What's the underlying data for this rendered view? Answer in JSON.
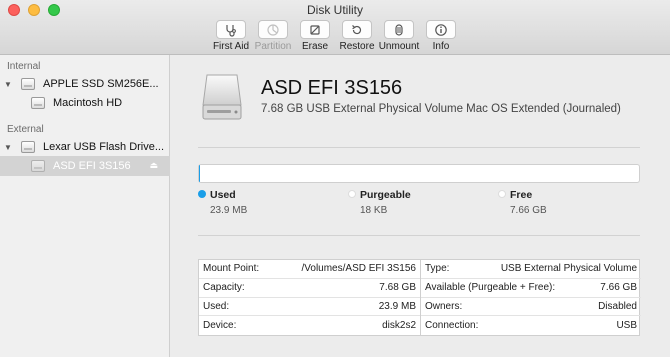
{
  "window": {
    "title": "Disk Utility"
  },
  "toolbar": [
    {
      "label": "First Aid",
      "icon": "stethoscope-icon",
      "enabled": true
    },
    {
      "label": "Partition",
      "icon": "pie-icon",
      "enabled": false
    },
    {
      "label": "Erase",
      "icon": "eraser-icon",
      "enabled": true
    },
    {
      "label": "Restore",
      "icon": "restore-icon",
      "enabled": true
    },
    {
      "label": "Unmount",
      "icon": "unmount-icon",
      "enabled": true
    },
    {
      "label": "Info",
      "icon": "info-icon",
      "enabled": true
    }
  ],
  "sidebar": {
    "internal_header": "Internal",
    "external_header": "External",
    "items": [
      {
        "label": "APPLE SSD SM256E...",
        "level": 0,
        "expanded": true
      },
      {
        "label": "Macintosh HD",
        "level": 1
      },
      {
        "label": "Lexar USB Flash Drive...",
        "level": 0,
        "expanded": true
      },
      {
        "label": "ASD EFI 3S156",
        "level": 1,
        "selected": true,
        "eject": "⏏"
      }
    ]
  },
  "volume": {
    "name": "ASD EFI 3S156",
    "subtitle": "7.68 GB USB External Physical Volume Mac OS Extended (Journaled)"
  },
  "usage": {
    "used_fraction": 0.003,
    "legend": [
      {
        "name": "Used",
        "value": "23.9 MB",
        "color": "#1a9ee8"
      },
      {
        "name": "Purgeable",
        "value": "18 KB",
        "color": "#ffffff"
      },
      {
        "name": "Free",
        "value": "7.66 GB",
        "color": "#ffffff"
      }
    ]
  },
  "info": {
    "left": [
      {
        "key": "Mount Point:",
        "value": "/Volumes/ASD EFI 3S156"
      },
      {
        "key": "Capacity:",
        "value": "7.68 GB"
      },
      {
        "key": "Used:",
        "value": "23.9 MB"
      },
      {
        "key": "Device:",
        "value": "disk2s2"
      }
    ],
    "right": [
      {
        "key": "Type:",
        "value": "USB External Physical Volume"
      },
      {
        "key": "Available (Purgeable + Free):",
        "value": "7.66 GB"
      },
      {
        "key": "Owners:",
        "value": "Disabled"
      },
      {
        "key": "Connection:",
        "value": "USB"
      }
    ]
  }
}
